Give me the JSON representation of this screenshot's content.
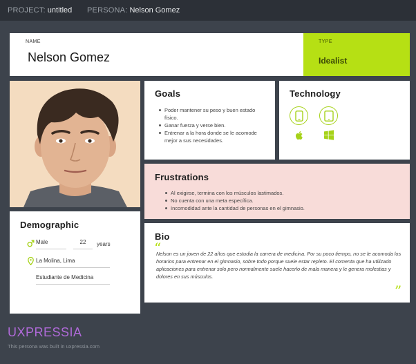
{
  "topbar": {
    "project_key": "PROJECT:",
    "project_value": "untitled",
    "persona_key": "PERSONA:",
    "persona_value": "Nelson Gomez"
  },
  "name_card": {
    "label": "NAME",
    "value": "Nelson Gomez"
  },
  "type_card": {
    "label": "TYPE",
    "value": "Idealist"
  },
  "goals": {
    "title": "Goals",
    "items": [
      "Poder mantener su peso y buen estado físico.",
      "Ganar fuerza y verse bien.",
      "Entrenar a la hora donde se le acomode mejor a sus necesidades."
    ]
  },
  "technology": {
    "title": "Technology",
    "icons": [
      "smartphone-icon",
      "tablet-icon",
      "apple-icon",
      "windows-icon"
    ]
  },
  "frustrations": {
    "title": "Frustrations",
    "items": [
      "Al exigirse, termina con los músculos lastimados.",
      "No cuenta con una meta específica.",
      "Incomodidad ante la cantidad de personas en el gimnasio."
    ]
  },
  "demographic": {
    "title": "Demographic",
    "gender": "Male",
    "age": "22",
    "age_unit": "years",
    "location": "La Molina, Lima",
    "occupation": "Estudiante de Medicina"
  },
  "bio": {
    "title": "Bio",
    "text": "Nelson es un joven de 22 años que estudia la carrera de medicina. Por su poco tiempo, no se le acomoda los horarios para entrenar en el gimnasio, sobre todo porque suele estar repleto. El comenta que ha utilizado aplicaciones para entrenar solo pero normalmente suele hacerlo de mala manera y le genera molestias y dolores en sus músculos.",
    "open_quote": "“",
    "close_quote": "”"
  },
  "branding": {
    "logo": "UXPRESSIA",
    "built_with": "This persona was built in uxpressia.com"
  },
  "colors": {
    "background": "#3d434c",
    "topbar": "#2c3037",
    "accent_green": "#b6e014",
    "frustration_bg": "#f8dcd9",
    "brand_purple": "#b06ad9"
  }
}
